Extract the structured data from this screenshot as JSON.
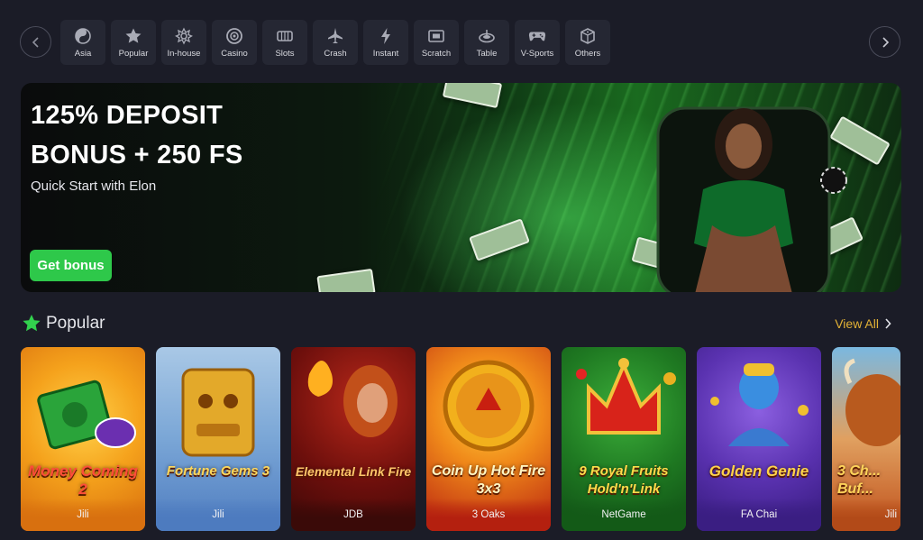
{
  "categories": [
    {
      "label": "Asia",
      "icon": "yin-yang-icon"
    },
    {
      "label": "Popular",
      "icon": "star-icon"
    },
    {
      "label": "In-house",
      "icon": "lotus-icon"
    },
    {
      "label": "Casino",
      "icon": "chip-icon"
    },
    {
      "label": "Slots",
      "icon": "slot-machine-icon"
    },
    {
      "label": "Crash",
      "icon": "plane-icon"
    },
    {
      "label": "Instant",
      "icon": "lightning-icon"
    },
    {
      "label": "Scratch",
      "icon": "ticket-icon"
    },
    {
      "label": "Table",
      "icon": "roulette-icon"
    },
    {
      "label": "V-Sports",
      "icon": "gamepad-icon"
    },
    {
      "label": "Others",
      "icon": "dice-icon"
    }
  ],
  "banner": {
    "title_line1": "125% DEPOSIT",
    "title_line2": "BONUS + 250 FS",
    "subtitle": "Quick Start with Elon",
    "button_label": "Get bonus"
  },
  "popular": {
    "title": "Popular",
    "view_all_label": "View All",
    "games": [
      {
        "name": "Money Coming 2",
        "provider": "Jili"
      },
      {
        "name": "Fortune Gems 3",
        "provider": "Jili"
      },
      {
        "name": "Elemental Link Fire",
        "provider": "JDB"
      },
      {
        "name": "Coin Up Hot Fire 3x3",
        "provider": "3 Oaks"
      },
      {
        "name": "9 Royal Fruits Hold'n'Link",
        "provider": "NetGame"
      },
      {
        "name": "Golden Genie",
        "provider": "FA Chai"
      },
      {
        "name": "3 Ch... Buf...",
        "provider": "Jili"
      }
    ]
  },
  "colors": {
    "background": "#1b1c27",
    "tile": "#252733",
    "accent_green": "#2ec84a",
    "view_all_gold": "#e3b236"
  }
}
